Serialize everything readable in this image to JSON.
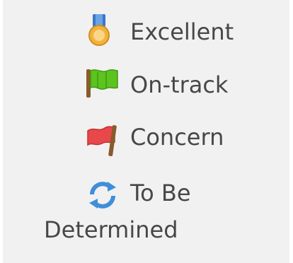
{
  "status_list": {
    "items": [
      {
        "key": "excellent",
        "icon": "medal-icon",
        "label": "Excellent"
      },
      {
        "key": "on-track",
        "icon": "green-flag-icon",
        "label": "On-track"
      },
      {
        "key": "concern",
        "icon": "red-flag-icon",
        "label": "Concern"
      },
      {
        "key": "to-be-determined",
        "icon": "refresh-icon",
        "label_line1": "To Be",
        "label_line2": "Determined"
      }
    ]
  },
  "colors": {
    "background": "#f1f1f1",
    "text": "#474747",
    "medal_ribbon": "#3b78c8",
    "medal_gold": "#f2b33d",
    "flag_green": "#5cc31f",
    "flag_red": "#e8484a",
    "pole_brown": "#8a5a2b",
    "refresh_blue": "#3f8fd8"
  }
}
